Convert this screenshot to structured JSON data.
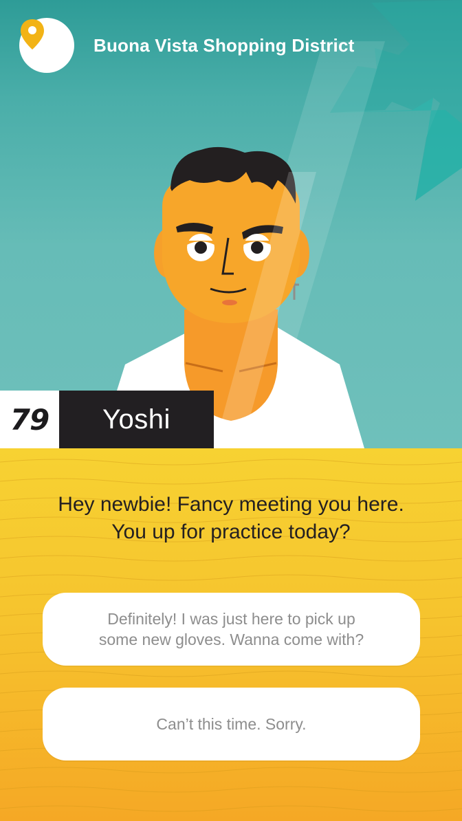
{
  "location": {
    "title": "Buona Vista Shopping District",
    "icon": "map-pin-icon",
    "icon_color": "#f2b316"
  },
  "character": {
    "name": "Yoshi",
    "level": "79"
  },
  "dialogue": {
    "line1": "Hey newbie! Fancy meeting you here.",
    "line2": "You up for practice today?"
  },
  "choices": [
    {
      "line1": "Definitely! I was just here to pick up",
      "line2": "some new gloves. Wanna come with?"
    },
    {
      "line1": "Can’t this time. Sorry."
    }
  ],
  "colors": {
    "scene_teal": "#5fb7b2",
    "panel_yellow": "#f7d232",
    "panel_orange": "#f5a825",
    "name_bg": "#221f22",
    "skin": "#f7a62a"
  }
}
